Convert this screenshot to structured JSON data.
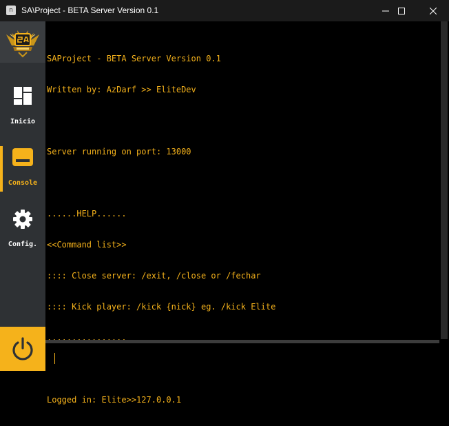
{
  "window": {
    "title": "SA\\Project - BETA Server Version 0.1",
    "app_icon_glyph": "n",
    "controls": [
      "minimize-icon",
      "maximize-icon",
      "close-icon"
    ]
  },
  "sidebar": {
    "logo_icon": "sa-project-logo",
    "items": [
      {
        "label": "Inicio",
        "icon": "dashboard-grid-icon",
        "active": false
      },
      {
        "label": "Console",
        "icon": "console-icon",
        "active": true
      },
      {
        "label": "Config.",
        "icon": "gear-icon",
        "active": false
      }
    ],
    "power_icon": "power-icon"
  },
  "console": {
    "lines": [
      "SAProject - BETA Server Version 0.1",
      "Written by: AzDarf >> EliteDev",
      "",
      "Server running on port: 13000",
      "",
      "......HELP......",
      "<<Command list>>",
      ":::: Close server: /exit, /close or /fechar",
      ":::: Kick player: /kick {nick} eg. /kick Elite",
      "................",
      "",
      "Logged in: Elite>>127.0.0.1"
    ]
  },
  "input": {
    "value": "",
    "placeholder": ""
  },
  "colors": {
    "accent": "#f5b21b",
    "sidebar": "#2e3134",
    "titlebar": "#1b1b1b",
    "console_bg": "#000000"
  }
}
